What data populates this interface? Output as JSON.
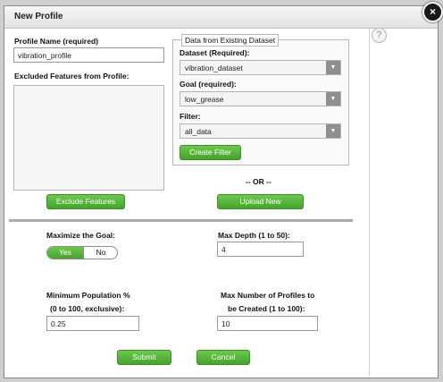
{
  "dialog": {
    "title": "New Profile",
    "close_label": "×",
    "help_label": "?"
  },
  "profile_name": {
    "label": "Profile Name (required)",
    "value": "vibration_profile"
  },
  "excluded": {
    "label": "Excluded Features from Profile:"
  },
  "dataset_box": {
    "legend": "Data from Existing Dataset",
    "dataset_label": "Dataset (Required):",
    "dataset_value": "vibration_dataset",
    "goal_label": "Goal (required):",
    "goal_value": "low_grease",
    "filter_label": "Filter:",
    "filter_value": "all_data",
    "create_filter": "Create Filter"
  },
  "or_text": "-- OR --",
  "buttons": {
    "exclude": "Exclude Features",
    "upload": "Upload New",
    "submit": "Submit",
    "cancel": "Cancel"
  },
  "maximize": {
    "label": "Maximize the Goal:",
    "yes": "Yes",
    "no": "No",
    "selected": "Yes"
  },
  "max_depth": {
    "label": "Max Depth (1 to 50):",
    "value": "4"
  },
  "min_pop": {
    "label_line1": "Minimum Population %",
    "label_line2": "(0 to 100, exclusive):",
    "value": "0.25"
  },
  "max_profiles": {
    "label_line1": "Max Number of Profiles to",
    "label_line2": "be Created (1 to 100):",
    "value": "10"
  },
  "colors": {
    "accent_green": "#45a32b",
    "border_gray": "#9a9a9a"
  },
  "icons": {
    "close": "close-icon",
    "help": "help-icon",
    "dropdown": "chevron-down-icon"
  }
}
